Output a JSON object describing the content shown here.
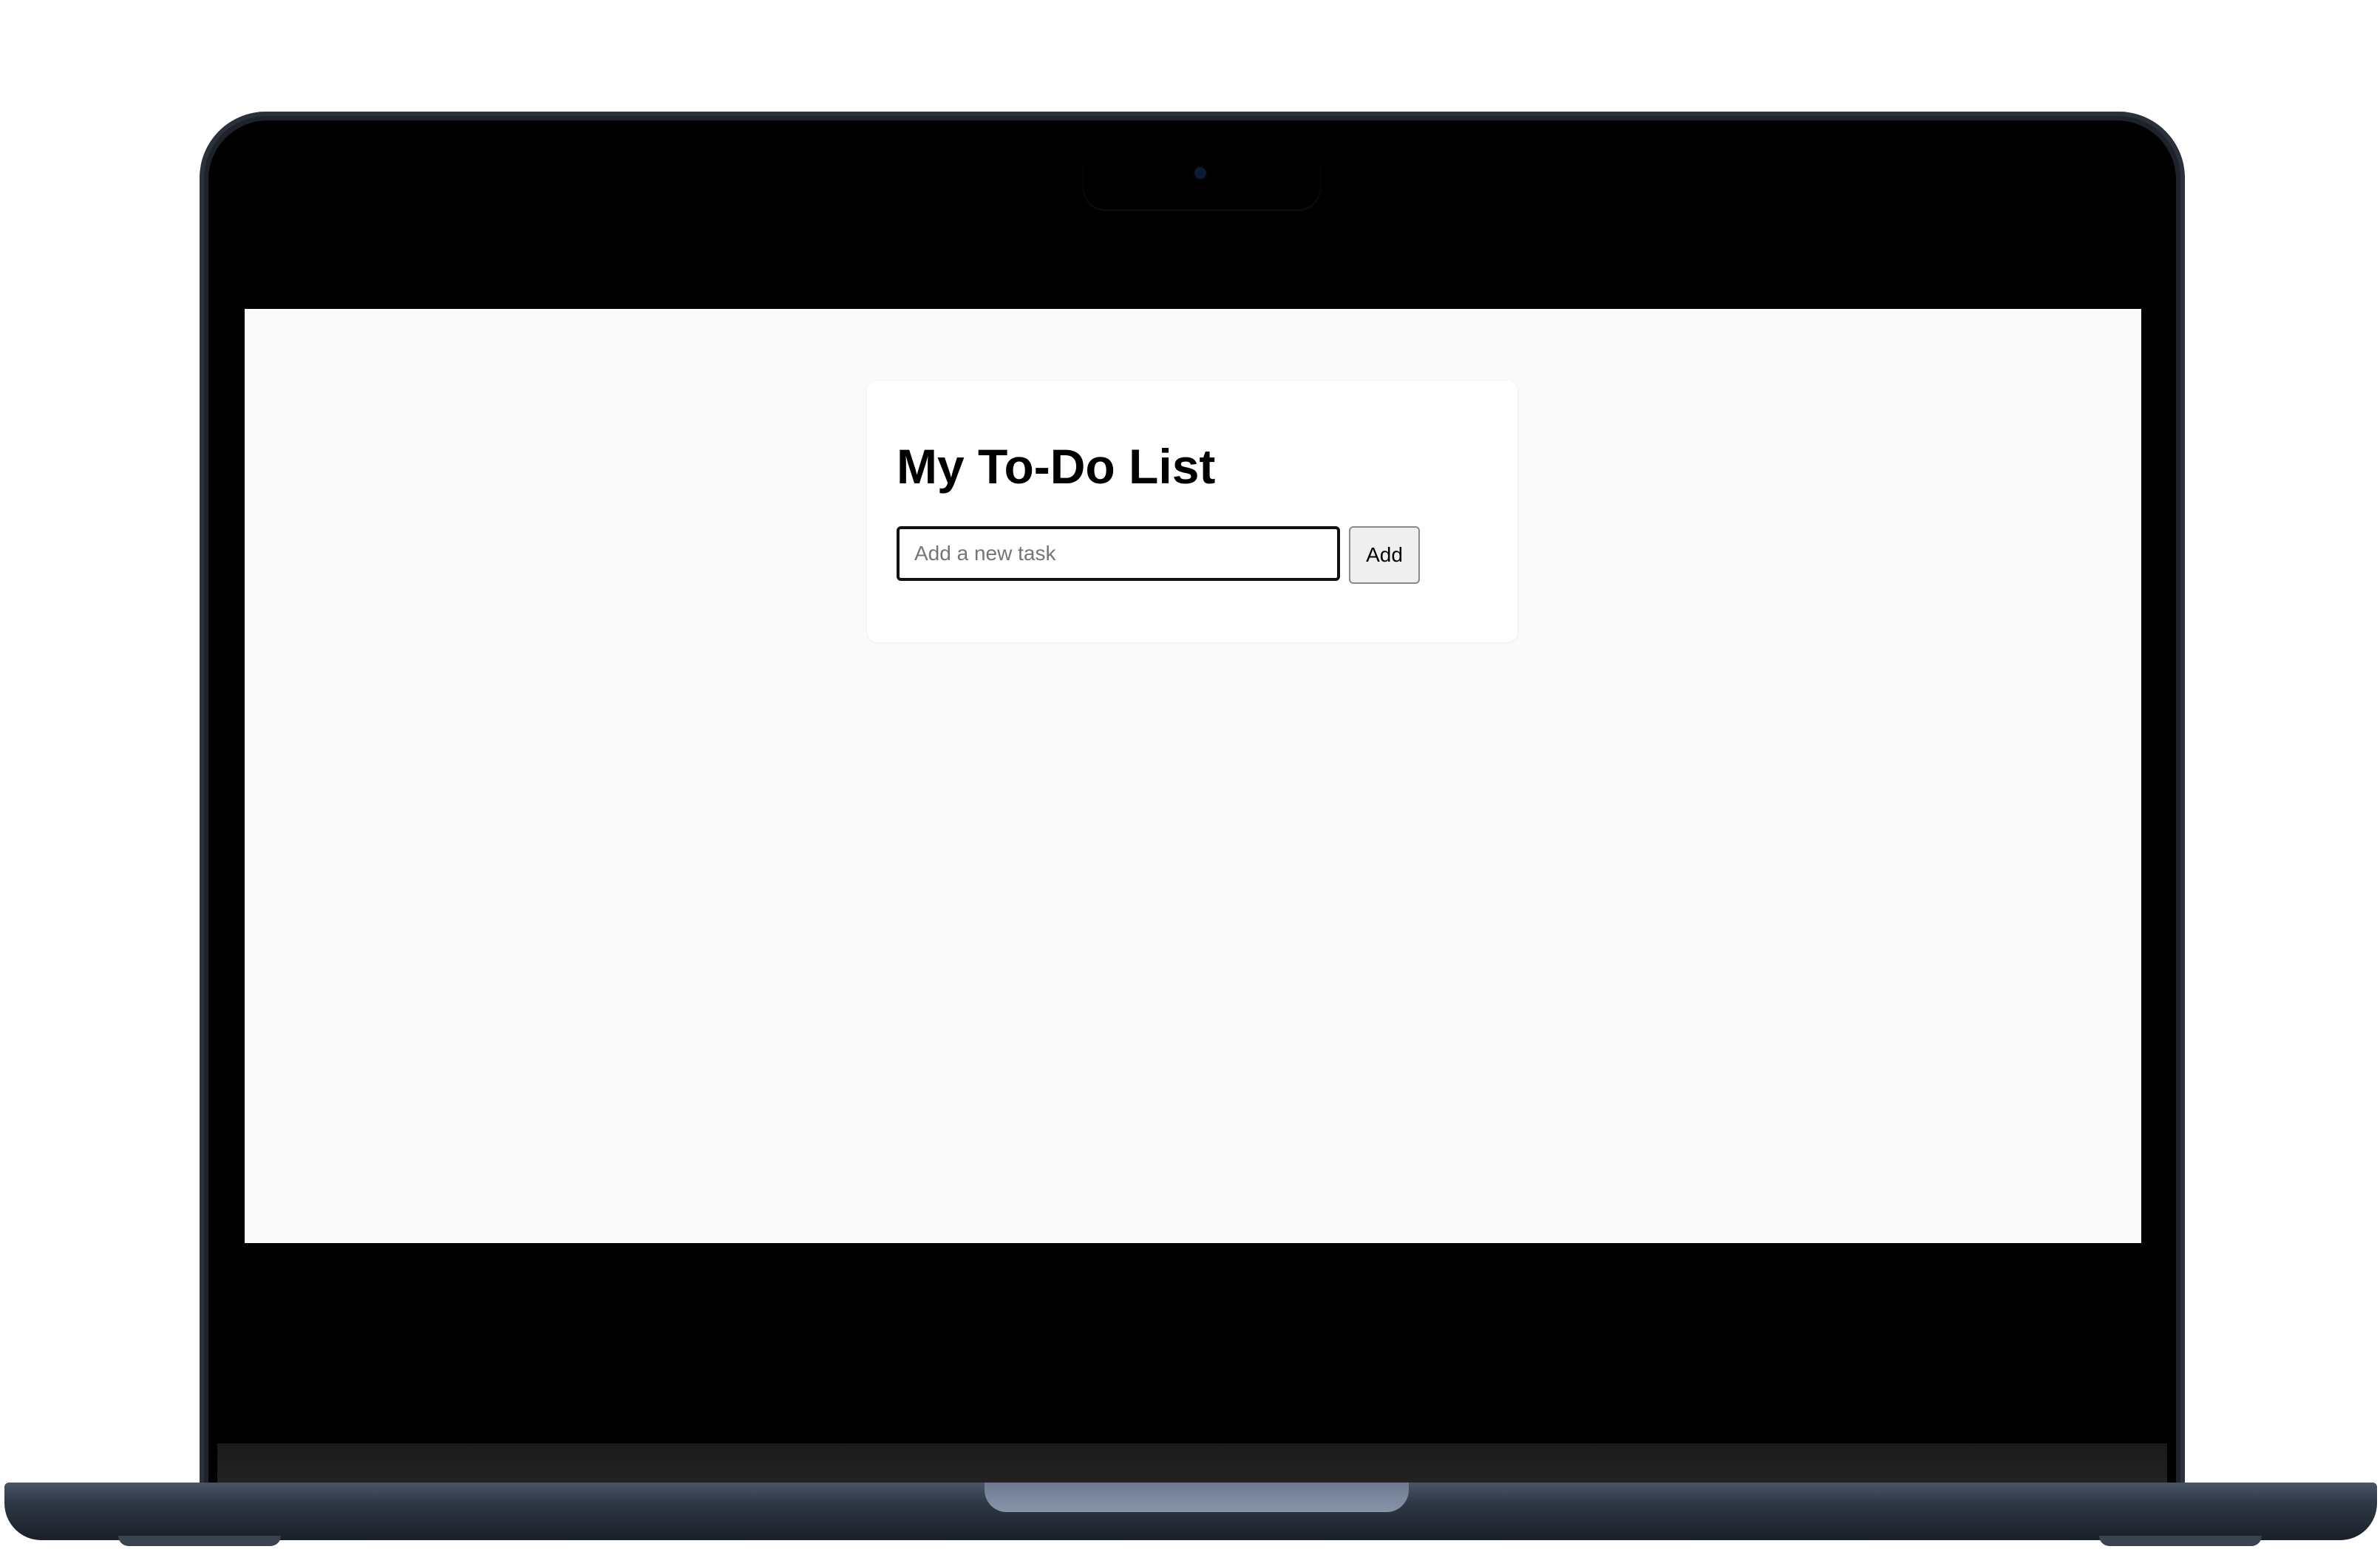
{
  "app": {
    "title": "My To-Do List"
  },
  "task_form": {
    "input_value": "",
    "input_placeholder": "Add a new task",
    "add_label": "Add"
  },
  "colors": {
    "page_background": "#fafafa",
    "card_background": "#ffffff",
    "button_background": "#efefef",
    "laptop_body": "#1d222b"
  },
  "icons": {
    "camera": "camera-icon"
  }
}
